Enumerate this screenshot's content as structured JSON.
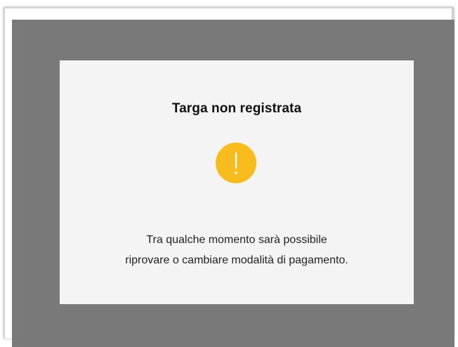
{
  "colors": {
    "overlay": "#797979",
    "dialog_background": "#f4f4f4",
    "warning_icon": "#f8bd1c",
    "title_text": "#111111",
    "body_text": "#222222"
  },
  "dialog": {
    "title": "Targa non registrata",
    "icon": "warning-exclamation-icon",
    "message_line_1": "Tra qualche momento sarà possibile",
    "message_line_2": "riprovare o cambiare modalità di pagamento."
  }
}
